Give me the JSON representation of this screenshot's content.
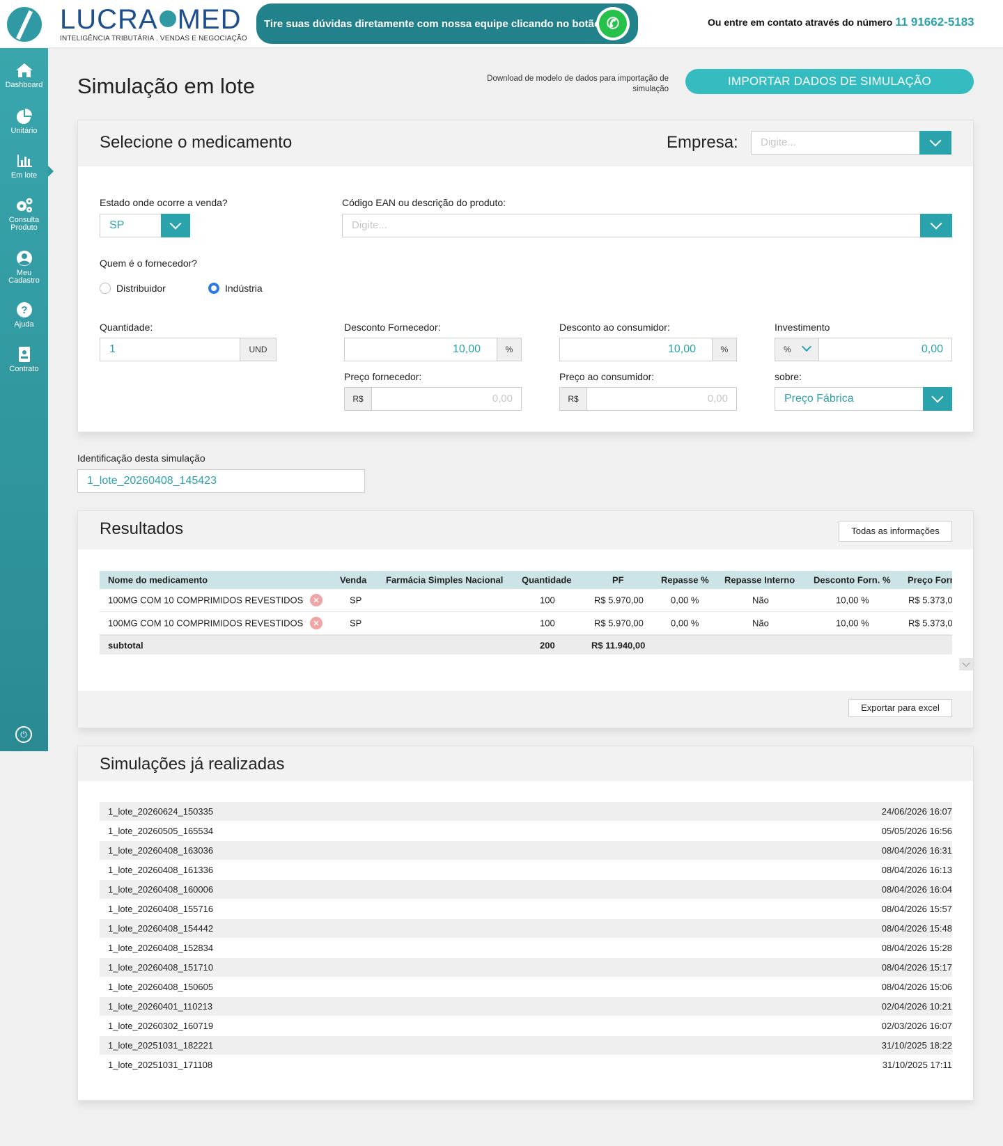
{
  "topbar": {
    "brand_name_left": "LUCRA",
    "brand_name_right": "MED",
    "brand_tagline": "INTELIGÊNCIA TRIBUTÁRIA . VENDAS E NEGOCIAÇÃO",
    "help_text": "Tire suas dúvidas diretamente com nossa equipe clicando no botão",
    "contact_prefix": "Ou entre em contato através do número",
    "contact_phone": "11 91662-5183"
  },
  "sidebar": {
    "items": [
      {
        "label": "Dashboard",
        "icon": "home-icon"
      },
      {
        "label": "Unitário",
        "icon": "pie-chart-icon"
      },
      {
        "label": "Em lote",
        "icon": "bar-chart-icon"
      },
      {
        "label": "Consulta Produto",
        "icon": "gears-icon"
      },
      {
        "label": "Meu Cadastro",
        "icon": "user-icon"
      },
      {
        "label": "Ajuda",
        "icon": "help-icon"
      },
      {
        "label": "Contrato",
        "icon": "contract-icon"
      }
    ],
    "active": "Em lote"
  },
  "page": {
    "title": "Simulação em lote",
    "download_note": "Download de modelo de dados para importação de simulação",
    "import_button": "IMPORTAR DADOS DE SIMULAÇÃO"
  },
  "select_panel": {
    "title": "Selecione o medicamento",
    "empresa_label": "Empresa:",
    "empresa_placeholder": "Digite...",
    "estado_label": "Estado onde ocorre a venda?",
    "estado_value": "SP",
    "ean_label": "Código EAN ou descrição do produto:",
    "ean_placeholder": "Digite...",
    "fornecedor_label": "Quem é o fornecedor?",
    "fornecedor_options": [
      "Distribuidor",
      "Indústria"
    ],
    "fornecedor_selected": "Indústria",
    "quantidade_label": "Quantidade:",
    "quantidade_value": "1",
    "quantidade_unit": "UND",
    "desc_forn_label": "Desconto Fornecedor:",
    "desc_forn_value": "10,00",
    "desc_cons_label": "Desconto ao consumidor:",
    "desc_cons_value": "10,00",
    "percent": "%",
    "invest_label": "Investimento",
    "invest_unit": "%",
    "invest_value": "0,00",
    "preco_forn_label": "Preço fornecedor:",
    "preco_forn_value": "0,00",
    "preco_cons_label": "Preço ao consumidor:",
    "preco_cons_value": "0,00",
    "currency": "R$",
    "sobre_label": "sobre:",
    "sobre_value": "Preço Fábrica"
  },
  "identificacao": {
    "label": "Identificação desta simulação",
    "value": "1_lote_20260408_145423"
  },
  "results": {
    "title": "Resultados",
    "all_info_button": "Todas as informações",
    "export_button": "Exportar para excel",
    "columns": [
      "Nome do medicamento",
      "Venda",
      "Farmácia Simples Nacional",
      "Quantidade",
      "PF",
      "Repasse %",
      "Repasse Interno",
      "Desconto Forn. %",
      "Preço Forn"
    ],
    "rows": [
      {
        "nome": "100MG COM 10 COMPRIMIDOS REVESTIDOS",
        "venda": "SP",
        "farmacia": "",
        "quantidade": "100",
        "pf": "R$ 5.970,00",
        "repasse": "0,00 %",
        "repasse_interno": "Não",
        "desconto": "10,00 %",
        "preco_forn": "R$ 5.373,0"
      },
      {
        "nome": "100MG COM 10 COMPRIMIDOS REVESTIDOS",
        "venda": "SP",
        "farmacia": "",
        "quantidade": "100",
        "pf": "R$ 5.970,00",
        "repasse": "0,00 %",
        "repasse_interno": "Não",
        "desconto": "10,00 %",
        "preco_forn": "R$ 5.373,0"
      }
    ],
    "subtotal": {
      "label": "subtotal",
      "quantidade": "200",
      "pf": "R$ 11.940,00"
    }
  },
  "history": {
    "title": "Simulações já realizadas",
    "items": [
      {
        "name": "1_lote_20260624_150335",
        "date": "24/06/2026 16:07"
      },
      {
        "name": "1_lote_20260505_165534",
        "date": "05/05/2026 16:56"
      },
      {
        "name": "1_lote_20260408_163036",
        "date": "08/04/2026 16:31"
      },
      {
        "name": "1_lote_20260408_161336",
        "date": "08/04/2026 16:13"
      },
      {
        "name": "1_lote_20260408_160006",
        "date": "08/04/2026 16:04"
      },
      {
        "name": "1_lote_20260408_155716",
        "date": "08/04/2026 15:57"
      },
      {
        "name": "1_lote_20260408_154442",
        "date": "08/04/2026 15:48"
      },
      {
        "name": "1_lote_20260408_152834",
        "date": "08/04/2026 15:28"
      },
      {
        "name": "1_lote_20260408_151710",
        "date": "08/04/2026 15:17"
      },
      {
        "name": "1_lote_20260408_150605",
        "date": "08/04/2026 15:06"
      },
      {
        "name": "1_lote_20260401_110213",
        "date": "02/04/2026 10:21"
      },
      {
        "name": "1_lote_20260302_160719",
        "date": "02/03/2026 16:07"
      },
      {
        "name": "1_lote_20251031_182221",
        "date": "31/10/2025 18:22"
      },
      {
        "name": "1_lote_20251031_171108",
        "date": "31/10/2025 17:11"
      }
    ]
  }
}
